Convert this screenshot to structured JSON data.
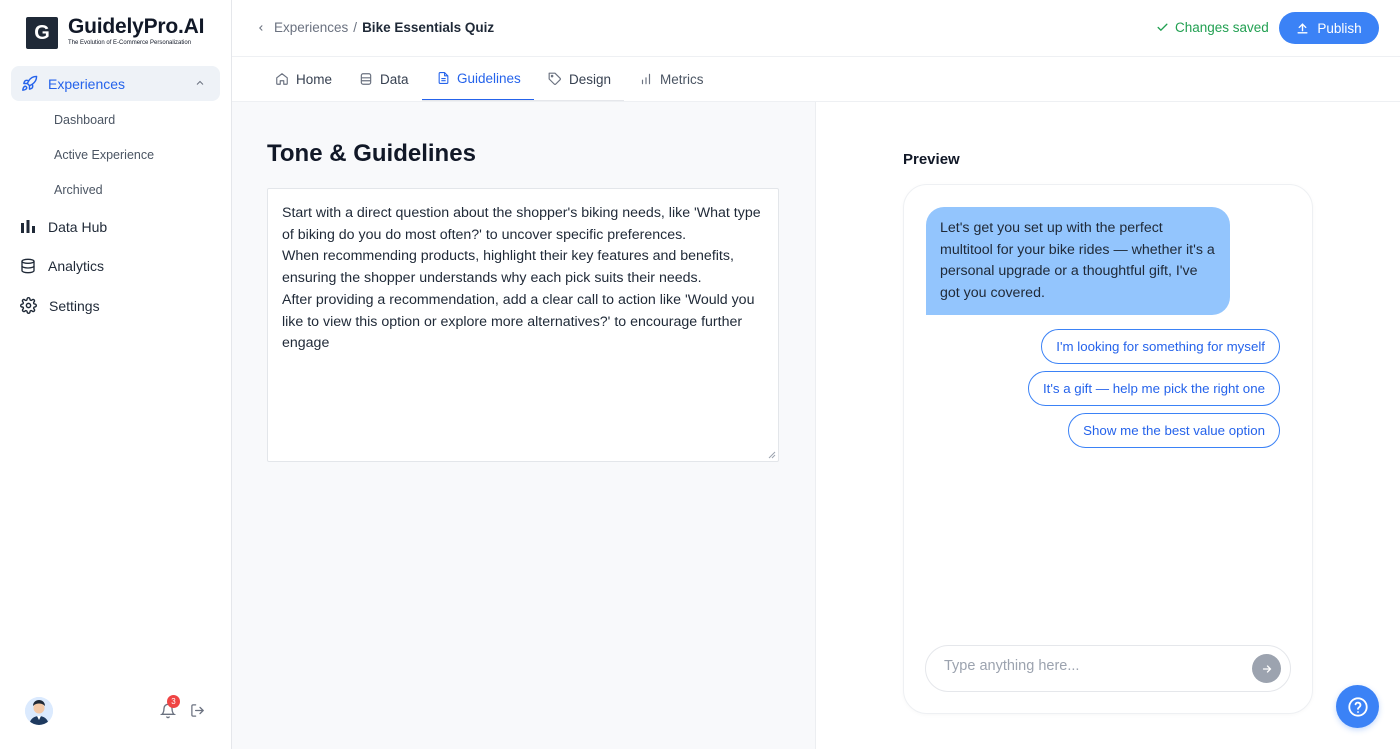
{
  "brand": {
    "mark": "G",
    "name": "GuidelyPro.AI",
    "tagline": "The Evolution of E-Commerce Personalization"
  },
  "sidebar": {
    "active_section": "Experiences",
    "sub_items": [
      "Dashboard",
      "Active Experience",
      "Archived"
    ],
    "items": [
      {
        "label": "Data Hub",
        "icon": "bar-chart-icon"
      },
      {
        "label": "Analytics",
        "icon": "database-icon"
      },
      {
        "label": "Settings",
        "icon": "gear-icon"
      }
    ],
    "notification_count": "3"
  },
  "header": {
    "breadcrumb_parent": "Experiences",
    "breadcrumb_separator": "/",
    "breadcrumb_current": "Bike Essentials Quiz",
    "status": "Changes saved",
    "publish_label": "Publish"
  },
  "tabs": [
    {
      "label": "Home",
      "icon": "home-icon"
    },
    {
      "label": "Data",
      "icon": "database-icon"
    },
    {
      "label": "Guidelines",
      "icon": "document-icon",
      "active": true
    },
    {
      "label": "Design",
      "icon": "tag-icon"
    },
    {
      "label": "Metrics",
      "icon": "bar-chart-icon"
    }
  ],
  "main": {
    "title": "Tone & Guidelines",
    "guidelines_text": "Start with a direct question about the shopper's biking needs, like 'What type of biking do you do most often?' to uncover specific preferences.\nWhen recommending products, highlight their key features and benefits, ensuring the shopper understands why each pick suits their needs.\nAfter providing a recommendation, add a clear call to action like 'Would you like to view this option or explore more alternatives?' to encourage further engage"
  },
  "preview": {
    "title": "Preview",
    "bot_message": "Let's get you set up with the perfect multitool for your bike rides — whether it's a personal upgrade or a thoughtful gift, I've got you covered.",
    "choices": [
      "I'm looking for something for myself",
      "It's a gift — help me pick the right one",
      "Show me the best value option"
    ],
    "input_placeholder": "Type anything here..."
  },
  "colors": {
    "accent": "#3b82f6",
    "saved": "#22a052",
    "bubble": "#93c5fd"
  }
}
